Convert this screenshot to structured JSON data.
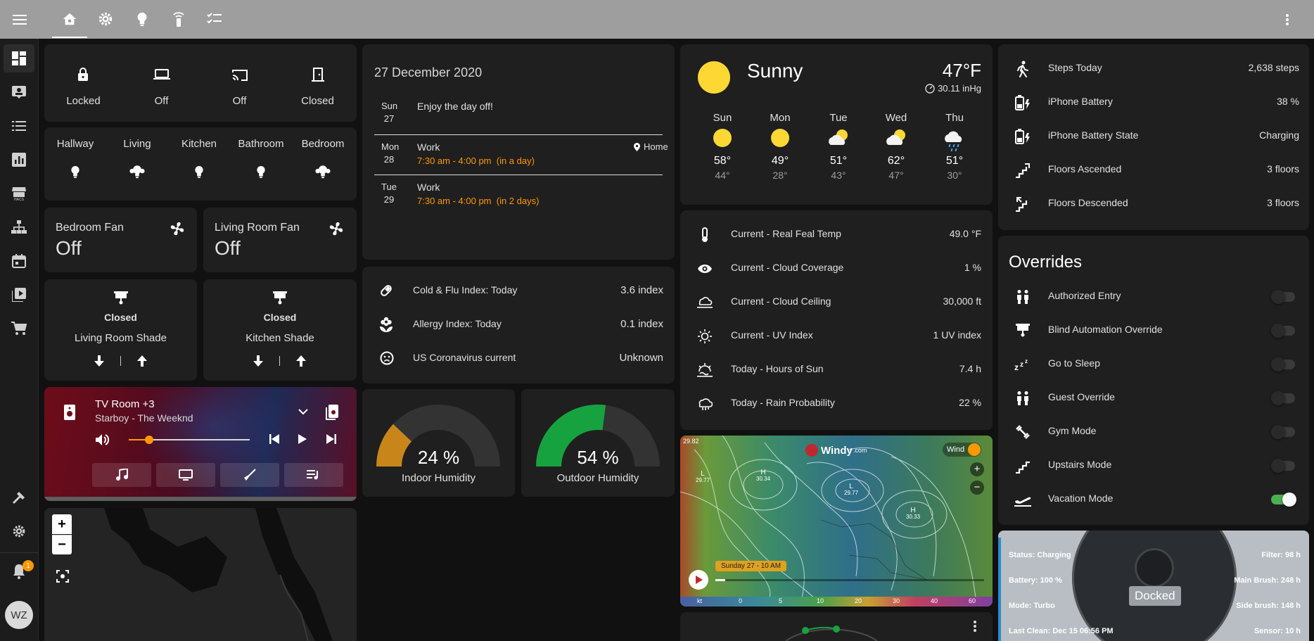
{
  "colors": {
    "accent": "#ff9800",
    "toggle_on": "#4caf50",
    "sun": "#fdd835",
    "indoor_gauge": "#c8861a",
    "outdoor_gauge": "#16a33f"
  },
  "nav": {
    "tabs": [
      "home-icon",
      "gear-icon",
      "bulb-icon",
      "remote-icon",
      "checklist-icon"
    ],
    "menu_icon": "hamburger-icon",
    "more_icon": "more-vert-icon"
  },
  "sidebar": {
    "items": [
      "dashboard-icon",
      "badge-icon",
      "list-icon",
      "chart-icon",
      "hacs-icon",
      "network-icon",
      "calendar-icon",
      "media-icon",
      "cart-icon"
    ],
    "dev_tools_icon": "hammer-icon",
    "settings_icon": "gear-icon",
    "notification_count": "1",
    "avatar": "WZ"
  },
  "status_tiles": [
    {
      "icon": "lock-icon",
      "label": "Locked"
    },
    {
      "icon": "laptop-icon",
      "label": "Off"
    },
    {
      "icon": "cast-icon",
      "label": "Off"
    },
    {
      "icon": "door-icon",
      "label": "Closed"
    }
  ],
  "lights": [
    {
      "name": "Hallway",
      "icon": "bulb-icon"
    },
    {
      "name": "Living",
      "icon": "bulb-group-icon"
    },
    {
      "name": "Kitchen",
      "icon": "bulb-icon"
    },
    {
      "name": "Bathroom",
      "icon": "bulb-icon"
    },
    {
      "name": "Bedroom",
      "icon": "bulb-group-icon"
    }
  ],
  "fans": [
    {
      "name": "Bedroom Fan",
      "state": "Off"
    },
    {
      "name": "Living Room Fan",
      "state": "Off"
    }
  ],
  "shades": [
    {
      "state": "Closed",
      "name": "Living Room Shade"
    },
    {
      "state": "Closed",
      "name": "Kitchen Shade"
    }
  ],
  "media": {
    "title": "TV Room +3",
    "subtitle": "Starboy - The Weeknd",
    "volume": 0.17,
    "buttons": [
      "music-icon",
      "tv-icon",
      "broom-icon",
      "playlist-icon"
    ]
  },
  "map": {
    "zoom_in": "+",
    "zoom_out": "−"
  },
  "calendar": {
    "date": "27 December 2020",
    "entries": [
      {
        "dow": "Sun",
        "day": "27",
        "title": "Enjoy the day off!",
        "time": "",
        "rel": "",
        "loc": ""
      },
      {
        "dow": "Mon",
        "day": "28",
        "title": "Work",
        "time": "7:30 am - 4:00 pm",
        "rel": "(in a day)",
        "loc": "Home"
      },
      {
        "dow": "Tue",
        "day": "29",
        "title": "Work",
        "time": "7:30 am - 4:00 pm",
        "rel": "(in 2 days)",
        "loc": ""
      }
    ]
  },
  "indices": [
    {
      "icon": "pill-icon",
      "label": "Cold & Flu Index: Today",
      "value": "3.6 index"
    },
    {
      "icon": "flower-icon",
      "label": "Allergy Index: Today",
      "value": "0.1 index"
    },
    {
      "icon": "sad-face-icon",
      "label": "US Coronavirus current",
      "value": "Unknown"
    }
  ],
  "humidity": [
    {
      "value": "24 %",
      "fraction": 0.24,
      "label": "Indoor Humidity"
    },
    {
      "value": "54 %",
      "fraction": 0.54,
      "label": "Outdoor Humidity"
    }
  ],
  "weather": {
    "condition": "Sunny",
    "temp": "47°F",
    "pressure": "30.11 inHg",
    "forecast": [
      {
        "day": "Sun",
        "icon": "sun-icon",
        "hi": "58°",
        "lo": "44°"
      },
      {
        "day": "Mon",
        "icon": "sun-icon",
        "hi": "49°",
        "lo": "28°"
      },
      {
        "day": "Tue",
        "icon": "partly-cloudy-icon",
        "hi": "51°",
        "lo": "43°"
      },
      {
        "day": "Wed",
        "icon": "partly-cloudy-icon",
        "hi": "62°",
        "lo": "47°"
      },
      {
        "day": "Thu",
        "icon": "rain-icon",
        "hi": "51°",
        "lo": "30°"
      }
    ]
  },
  "conditions": [
    {
      "icon": "thermometer-icon",
      "label": "Current - Real Feal Temp",
      "value": "49.0 °F"
    },
    {
      "icon": "eye-icon",
      "label": "Current - Cloud Coverage",
      "value": "1 %"
    },
    {
      "icon": "cloud-ceiling-icon",
      "label": "Current - Cloud Ceiling",
      "value": "30,000 ft"
    },
    {
      "icon": "uv-icon",
      "label": "Current - UV Index",
      "value": "1 UV index"
    },
    {
      "icon": "sun-clock-icon",
      "label": "Today - Hours of Sun",
      "value": "7.4 h"
    },
    {
      "icon": "rain-prob-icon",
      "label": "Today - Rain Probability",
      "value": "22 %"
    }
  ],
  "windy": {
    "brand": "Windy",
    "brand_suffix": ".com",
    "layer": "Wind",
    "timestamp": "Sunday 27 - 10 AM",
    "scale_unit": "kt",
    "scale": [
      "0",
      "5",
      "10",
      "20",
      "30",
      "40",
      "60"
    ],
    "pressure_labels": [
      {
        "t": "L",
        "v": "29.77"
      },
      {
        "t": "H",
        "v": "30.34"
      },
      {
        "t": "L",
        "v": "29.77"
      },
      {
        "t": "H",
        "v": "30.33"
      }
    ],
    "corner": "29.82"
  },
  "stats": [
    {
      "icon": "walk-icon",
      "label": "Steps Today",
      "value": "2,638 steps"
    },
    {
      "icon": "battery-charging-icon",
      "label": "iPhone Battery",
      "value": "38 %"
    },
    {
      "icon": "battery-charging-icon",
      "label": "iPhone Battery State",
      "value": "Charging"
    },
    {
      "icon": "stairs-up-icon",
      "label": "Floors Ascended",
      "value": "3 floors"
    },
    {
      "icon": "stairs-down-icon",
      "label": "Floors Descended",
      "value": "3 floors"
    }
  ],
  "overrides": {
    "title": "Overrides",
    "items": [
      {
        "icon": "people-icon",
        "label": "Authorized Entry",
        "on": false
      },
      {
        "icon": "blind-icon",
        "label": "Blind Automation Override",
        "on": false
      },
      {
        "icon": "sleep-icon",
        "label": "Go to Sleep",
        "on": false
      },
      {
        "icon": "people-icon",
        "label": "Guest Override",
        "on": false
      },
      {
        "icon": "dumbbell-icon",
        "label": "Gym Mode",
        "on": false
      },
      {
        "icon": "stairs-icon",
        "label": "Upstairs Mode",
        "on": false
      },
      {
        "icon": "airplane-icon",
        "label": "Vacation Mode",
        "on": true
      }
    ]
  },
  "vacuum": {
    "status": "Status: Charging",
    "battery": "Battery: 100 %",
    "mode": "Mode: Turbo",
    "last_clean": "Last Clean: Dec 15 06:56 PM",
    "filter": "Filter: 98 h",
    "main_brush": "Main Brush: 248 h",
    "side_brush": "Side brush: 148 h",
    "sensor": "Sensor: 10 h",
    "state": "Docked"
  }
}
